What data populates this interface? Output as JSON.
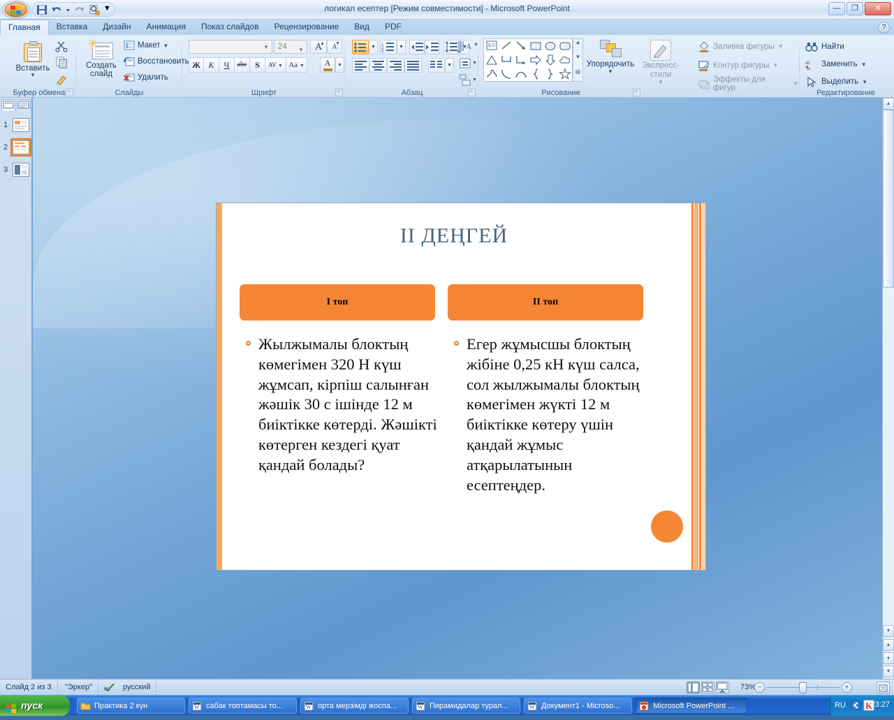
{
  "window": {
    "title": "логикал есептер [Режим совместимости] - Microsoft PowerPoint",
    "minimize": "—",
    "restore": "❐",
    "close": "✕",
    "help": "?"
  },
  "quick_access": {
    "save": "save-icon",
    "undo": "undo-icon",
    "redo": "redo-icon",
    "print_preview": "print-preview-icon",
    "customize": "▼"
  },
  "tabs": [
    {
      "label": "Главная",
      "active": true
    },
    {
      "label": "Вставка",
      "active": false
    },
    {
      "label": "Дизайн",
      "active": false
    },
    {
      "label": "Анимация",
      "active": false
    },
    {
      "label": "Показ слайдов",
      "active": false
    },
    {
      "label": "Рецензирование",
      "active": false
    },
    {
      "label": "Вид",
      "active": false
    },
    {
      "label": "PDF",
      "active": false
    }
  ],
  "ribbon": {
    "clipboard": {
      "group_label": "Буфер обмена",
      "paste_label": "Вставить",
      "paste_arrow": "▼",
      "cut": "Вырезать",
      "copy": "Копировать",
      "format_painter": "Формат по образцу"
    },
    "slides": {
      "group_label": "Слайды",
      "new_slide_label": "Создать слайд",
      "new_slide_arrow": "▼",
      "layout": "Макет",
      "layout_arrow": "▼",
      "reset": "Восстановить",
      "delete": "Удалить"
    },
    "font": {
      "group_label": "Шрифт",
      "font_name_value": "",
      "font_size_value": "24",
      "grow_font": "A",
      "shrink_font": "A",
      "clear_formatting": "Aa",
      "bold": "Ж",
      "italic": "К",
      "underline": "Ч",
      "strikethrough": "abc",
      "shadow": "S",
      "spacing": "AV",
      "change_case": "Aa",
      "font_color": "A"
    },
    "paragraph": {
      "group_label": "Абзац",
      "bullets": "Маркеры",
      "numbering": "Нумерация",
      "decrease_indent": "Уменьшить отступ",
      "increase_indent": "Увеличить отступ",
      "line_spacing": "Междустрочный интервал",
      "text_direction": "Направление текста",
      "align_left": "По левому краю",
      "align_center": "По центру",
      "align_right": "По правому краю",
      "justify": "По ширине",
      "columns": "Столбцы",
      "align_text": "Выровнять текст",
      "convert_smartart": "Преобразовать в SmartArt"
    },
    "drawing": {
      "group_label": "Рисование",
      "arrange_label": "Упорядочить",
      "arrange_arrow": "▼",
      "express_styles_label": "Экспресс-стили",
      "express_arrow": "▼",
      "shape_fill": "Заливка фигуры",
      "shape_outline": "Контур фигуры",
      "shape_effects": "Эффекты для фигур",
      "dropdown_arrow": "▼"
    },
    "editing": {
      "group_label": "Редактирование",
      "find": "Найти",
      "replace": "Заменить",
      "select": "Выделить",
      "dropdown_arrow": "▼"
    }
  },
  "slide_pane": {
    "tab_slides": "slides-tab-icon",
    "tab_outline": "outline-tab-icon",
    "thumbnails": [
      {
        "number": "1",
        "selected": false
      },
      {
        "number": "2",
        "selected": true
      },
      {
        "number": "3",
        "selected": false
      }
    ]
  },
  "slide": {
    "title": "II ДЕҢГЕЙ",
    "accent_color": "#f58634",
    "title_color": "#46627e",
    "columns": [
      {
        "header": "I топ",
        "body": "Жылжымалы блоктың көмегімен 320 Н күш жұмсап, кірпіш салынған жәшік 30 с ішінде 12 м биіктікке көтерді. Жәшікті көтерген кездегі қуат қандай болады?"
      },
      {
        "header": "II топ",
        "body": "Егер жұмысшы блоктың жібіне 0,25 кН күш салса, сол жылжымалы блоктың көмегімен жүкті 12 м биіктікке көтеру үшін қандай жұмыс атқарылатынын есептеңдер."
      }
    ]
  },
  "status_bar": {
    "slide_counter": "Слайд 2 из 3",
    "theme": "\"Эркер\"",
    "spellcheck_icon": "spellcheck-icon",
    "language": "русский",
    "view_normal": "normal-view-icon",
    "view_sorter": "slide-sorter-icon",
    "view_show": "slide-show-icon",
    "zoom_value": "73%",
    "zoom_out": "−",
    "zoom_in": "+",
    "fit_to_window": "fit-slide-icon"
  },
  "taskbar": {
    "start_label": "пуск",
    "items": [
      {
        "label": "Практика 2 күн",
        "icon": "folder-icon",
        "active": false
      },
      {
        "label": "сабак топтамасы то...",
        "icon": "word-icon",
        "active": false
      },
      {
        "label": "орта  мерзімді жоспа...",
        "icon": "word-icon",
        "active": false
      },
      {
        "label": "Пирамидалар турал...",
        "icon": "word-icon",
        "active": false
      },
      {
        "label": "Документ1 - Microso...",
        "icon": "word-icon",
        "active": false
      },
      {
        "label": "Microsoft PowerPoint ...",
        "icon": "powerpoint-icon",
        "active": true
      }
    ],
    "tray": {
      "language": "RU",
      "clock": "23:27",
      "icons": [
        "messenger-icon",
        "kaspersky-icon"
      ]
    }
  }
}
